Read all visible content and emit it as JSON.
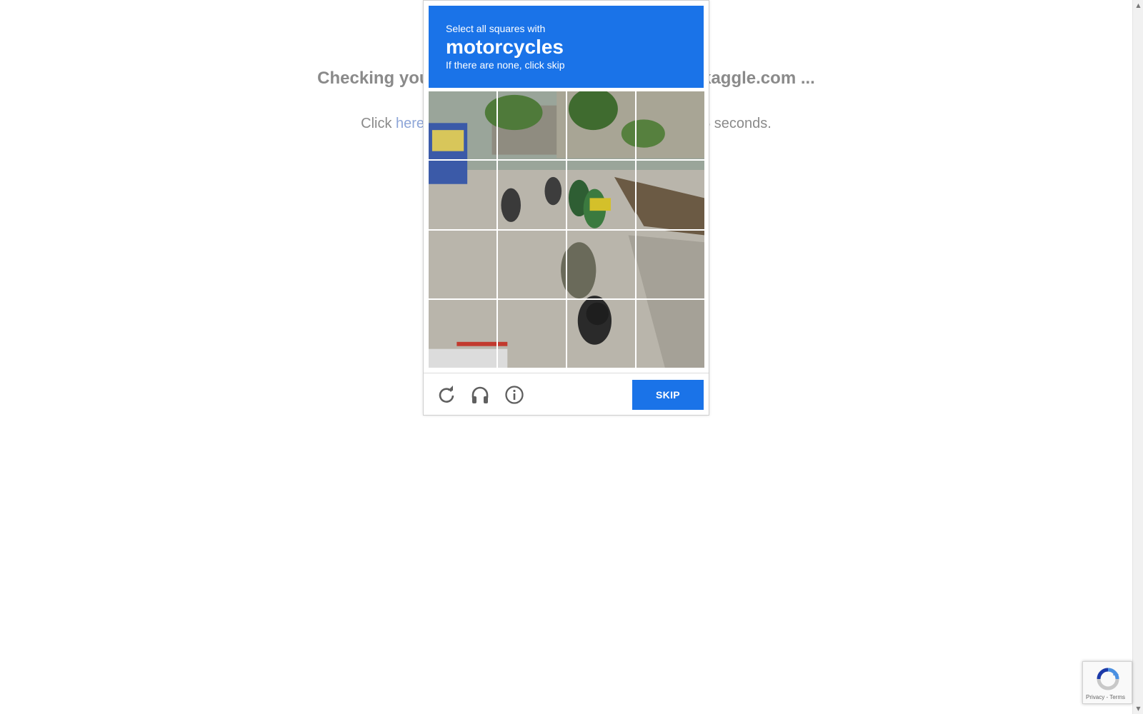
{
  "background": {
    "heading": "Checking your browser before accessing www.kaggle.com ...",
    "subtext_prefix": "Click ",
    "subtext_link": "here",
    "subtext_suffix": " if you are not automatically redirected after 5 seconds."
  },
  "challenge": {
    "instruction_line1": "Select all squares with",
    "keyword": "motorcycles",
    "instruction_line3": "If there are none, click skip",
    "grid_rows": 4,
    "grid_cols": 4,
    "tiles_selected": 0,
    "image_subject": "street scene with motorcycles",
    "colors": {
      "header_bg": "#1a73e8",
      "button_bg": "#1a73e8"
    }
  },
  "footer": {
    "icons": [
      "reload-icon",
      "audio-headphones-icon",
      "info-icon"
    ],
    "skip_label": "SKIP"
  },
  "badge": {
    "privacy_label": "Privacy",
    "separator": " - ",
    "terms_label": "Terms"
  }
}
